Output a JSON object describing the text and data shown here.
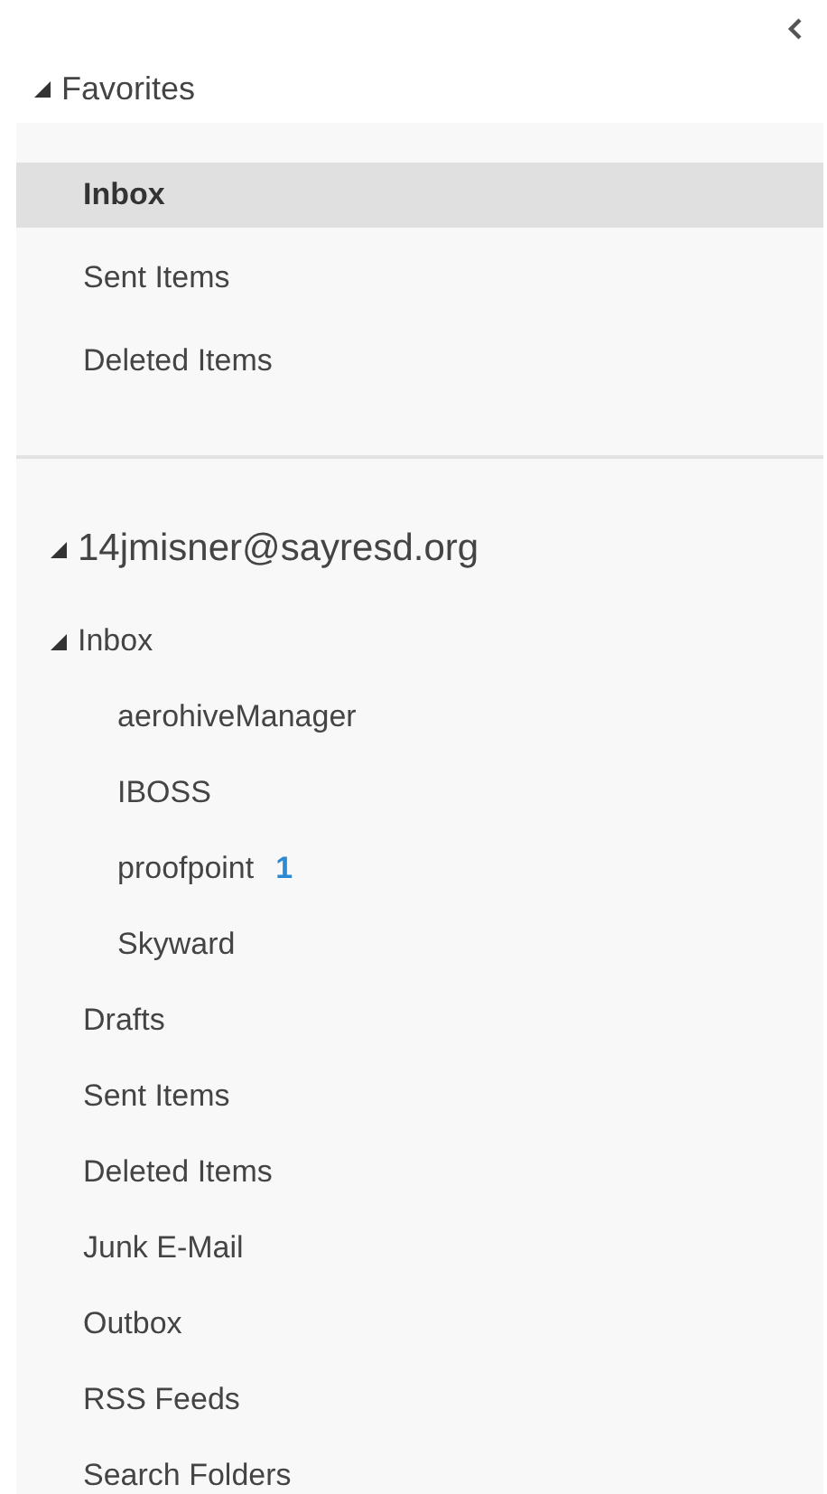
{
  "favorites": {
    "label": "Favorites",
    "expanded": true,
    "items": [
      {
        "label": "Inbox",
        "selected": true
      },
      {
        "label": "Sent Items",
        "selected": false
      },
      {
        "label": "Deleted Items",
        "selected": false
      }
    ]
  },
  "account": {
    "label": "14jmisner@sayresd.org",
    "expanded": true,
    "folders": [
      {
        "label": "Inbox",
        "expanded": true,
        "children": [
          {
            "label": "aerohiveManager"
          },
          {
            "label": "IBOSS"
          },
          {
            "label": "proofpoint",
            "unread": "1"
          },
          {
            "label": "Skyward"
          }
        ]
      },
      {
        "label": "Drafts"
      },
      {
        "label": "Sent Items"
      },
      {
        "label": "Deleted Items"
      },
      {
        "label": "Junk E-Mail"
      },
      {
        "label": "Outbox"
      },
      {
        "label": "RSS Feeds"
      },
      {
        "label": "Search Folders"
      }
    ]
  }
}
